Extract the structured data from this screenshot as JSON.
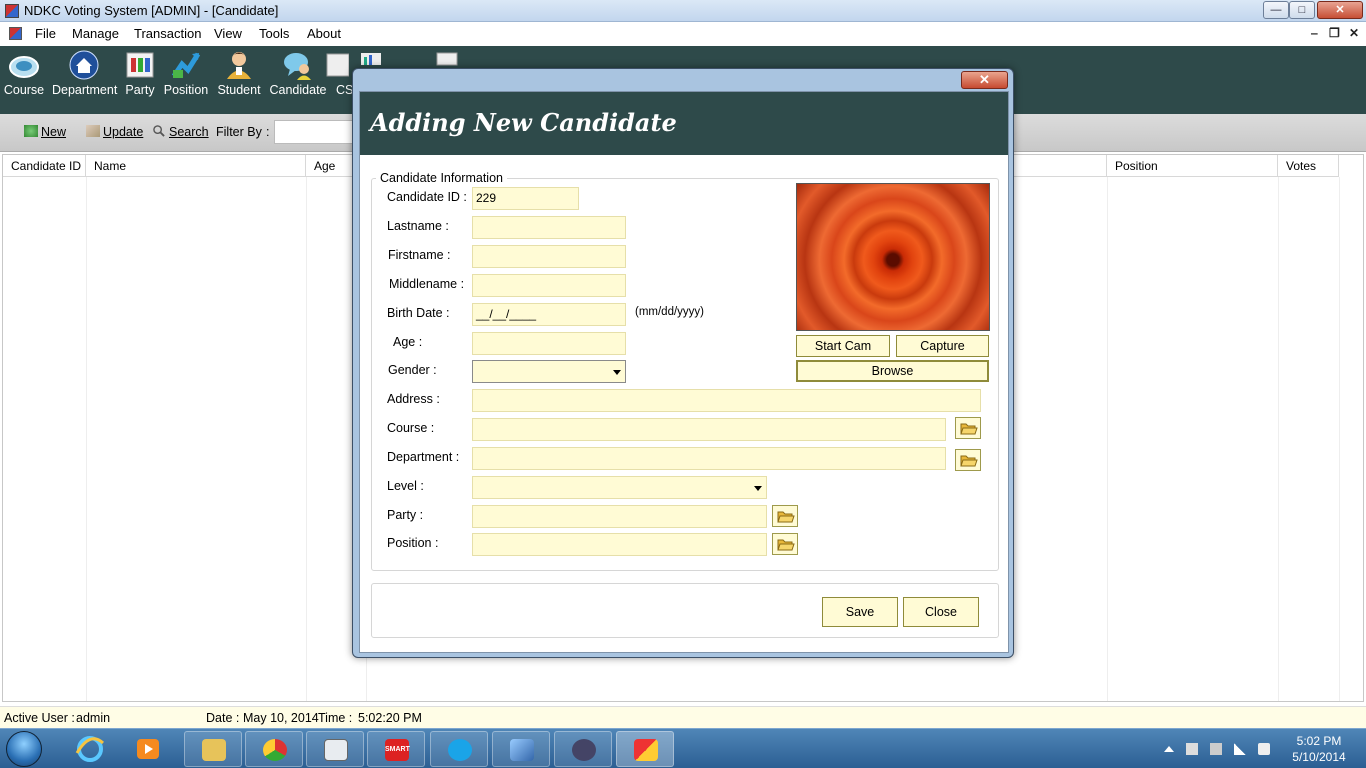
{
  "window": {
    "title": "NDKC Voting System [ADMIN] - [Candidate]",
    "min": "—",
    "max": "□",
    "close": "✕"
  },
  "menu": {
    "items": [
      "File",
      "Manage",
      "Transaction",
      "View",
      "Tools",
      "About"
    ],
    "mdi_min": "‒",
    "mdi_restore": "❐",
    "mdi_close": "✕"
  },
  "toolbar": {
    "items": [
      "Course",
      "Department",
      "Party",
      "Position",
      "Student",
      "Candidate",
      "CS"
    ]
  },
  "subbar": {
    "new": "New",
    "update": "Update",
    "search": "Search",
    "filter_by": "Filter By",
    "filter_colon": ":",
    "filter_value": ""
  },
  "grid": {
    "columns": [
      "Candidate ID",
      "Name",
      "Age",
      "Position",
      "Votes"
    ]
  },
  "dialog": {
    "title": "Adding New Candidate",
    "close": "✕",
    "group_title": "Candidate Information",
    "labels": {
      "candidate_id": "Candidate ID :",
      "lastname": "Lastname :",
      "firstname": "Firstname :",
      "middlename": "Middlename :",
      "birth_date": "Birth Date :",
      "age": "Age :",
      "gender": "Gender :",
      "address": "Address :",
      "course": "Course :",
      "department": "Department :",
      "level": "Level :",
      "party": "Party :",
      "position": "Position :"
    },
    "values": {
      "candidate_id": "229",
      "lastname": "",
      "firstname": "",
      "middlename": "",
      "birth_date": "__/__/____",
      "age": "",
      "gender": "",
      "address": "",
      "course": "",
      "department": "",
      "level": "",
      "party": "",
      "position": ""
    },
    "date_hint": "(mm/dd/yyyy)",
    "buttons": {
      "start_cam": "Start Cam",
      "capture": "Capture",
      "browse": "Browse",
      "save": "Save",
      "close": "Close"
    }
  },
  "status": {
    "active_user_label": "Active User :",
    "active_user": "admin",
    "date_label": "Date :",
    "date": "May 10, 2014",
    "time_label": "Time :",
    "time": "5:02:20 PM"
  },
  "taskbar": {
    "time": "5:02 PM",
    "date": "5/10/2014",
    "smart_label": "SMART"
  },
  "colors": {
    "accent_dark": "#2e4a4a",
    "field_bg": "#fffbd5",
    "taskbar": "#2c5f93"
  }
}
